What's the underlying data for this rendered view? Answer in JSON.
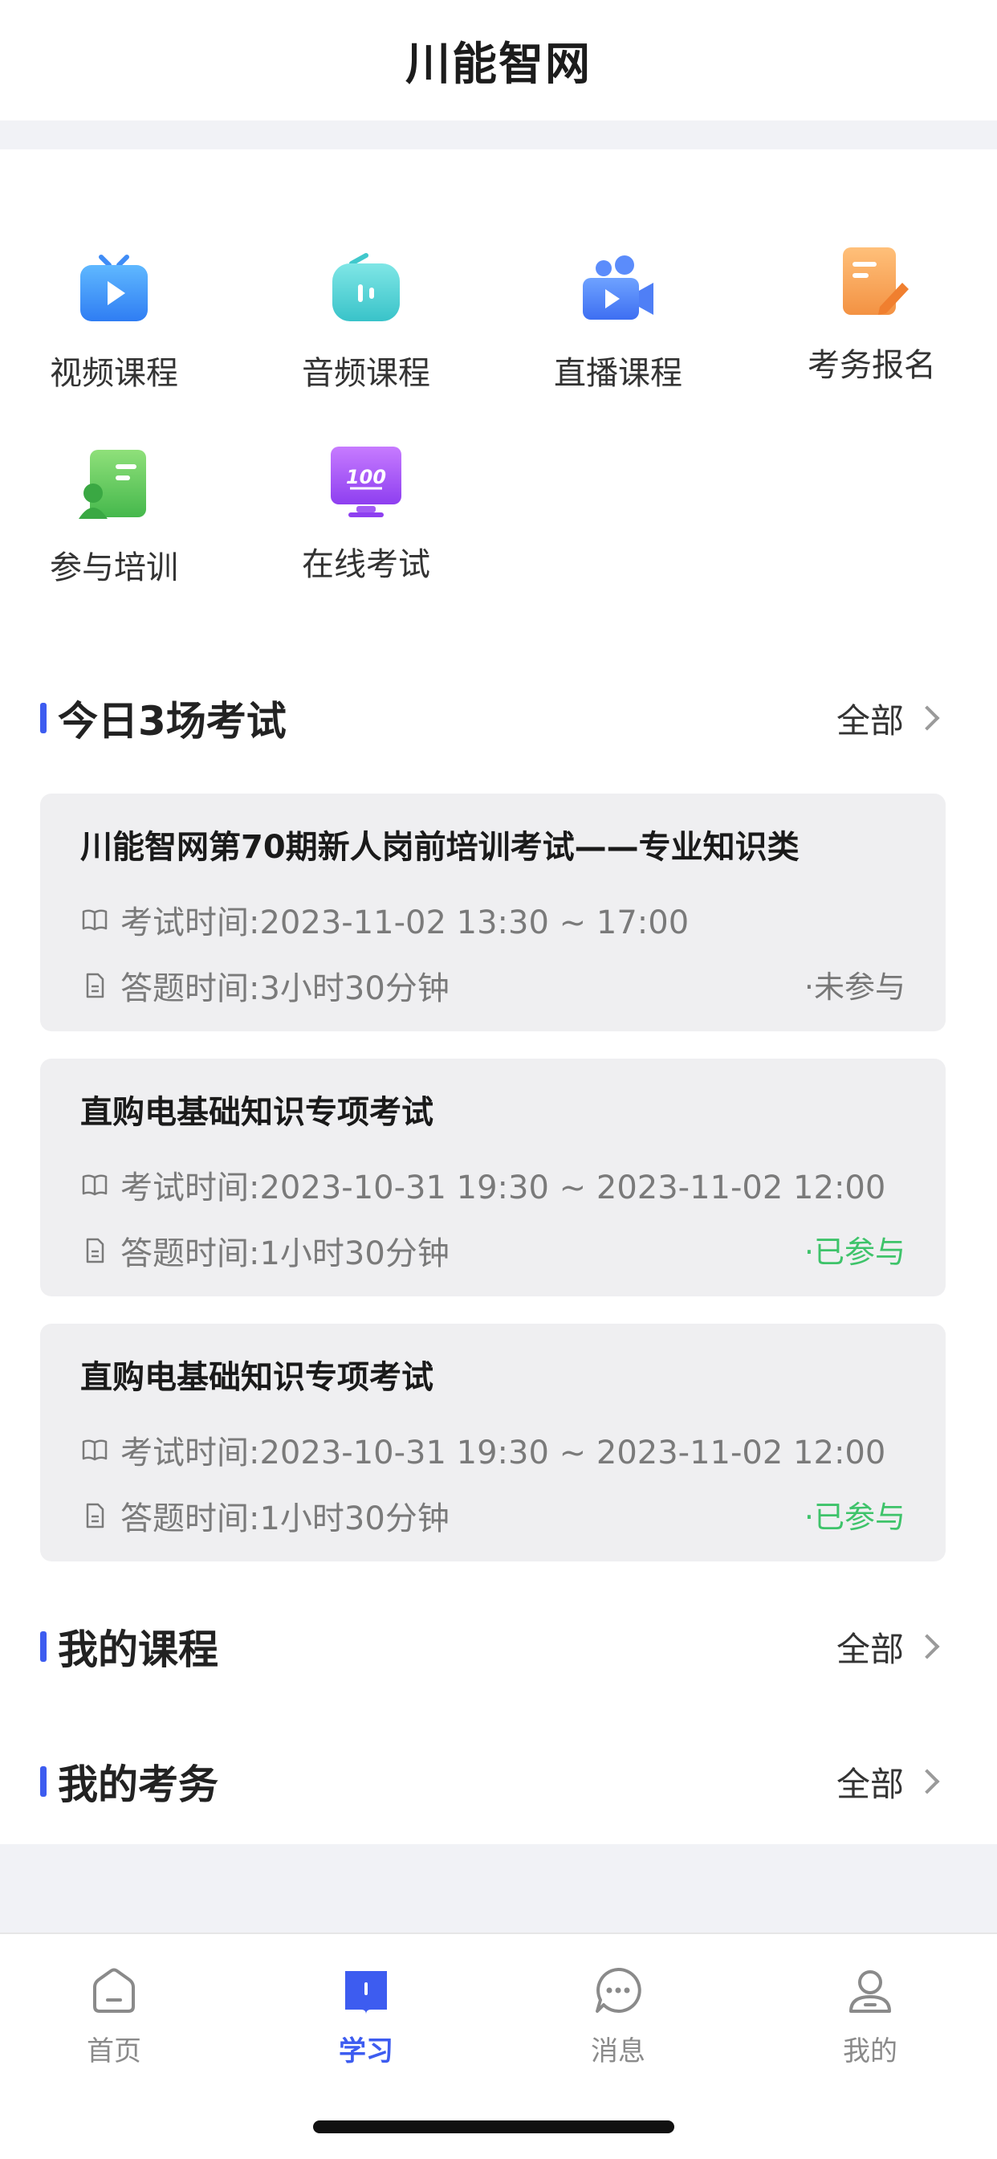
{
  "nav": {
    "title": "川能智网"
  },
  "quick_entries": [
    {
      "label": "视频课程",
      "icon": "video-tv-icon"
    },
    {
      "label": "音频课程",
      "icon": "audio-icon"
    },
    {
      "label": "直播课程",
      "icon": "live-camera-icon"
    },
    {
      "label": "考务报名",
      "icon": "signup-edit-icon"
    },
    {
      "label": "参与培训",
      "icon": "training-icon"
    },
    {
      "label": "在线考试",
      "icon": "online-exam-icon"
    }
  ],
  "today_exams": {
    "title": "今日3场考试",
    "more_label": "全部",
    "items": [
      {
        "title": "川能智网第70期新人岗前培训考试——专业知识类",
        "exam_time": "考试时间:2023-11-02 13:30 ~ 17:00",
        "answer_time": "答题时间:3小时30分钟",
        "status": "·未参与",
        "status_color": "#777777"
      },
      {
        "title": "直购电基础知识专项考试",
        "exam_time": "考试时间:2023-10-31 19:30 ~ 2023-11-02 12:00",
        "answer_time": "答题时间:1小时30分钟",
        "status": "·已参与",
        "status_color": "#3ec36a"
      },
      {
        "title": "直购电基础知识专项考试",
        "exam_time": "考试时间:2023-10-31 19:30 ~ 2023-11-02 12:00",
        "answer_time": "答题时间:1小时30分钟",
        "status": "·已参与",
        "status_color": "#3ec36a"
      }
    ]
  },
  "my_courses": {
    "title": "我的课程",
    "more_label": "全部"
  },
  "my_exams": {
    "title": "我的考务",
    "more_label": "全部"
  },
  "tabbar": {
    "active_color": "#3d5cf0",
    "items": [
      {
        "label": "首页",
        "icon": "home-icon",
        "active": false
      },
      {
        "label": "学习",
        "icon": "study-book-icon",
        "active": true
      },
      {
        "label": "消息",
        "icon": "message-icon",
        "active": false
      },
      {
        "label": "我的",
        "icon": "profile-icon",
        "active": false
      }
    ]
  },
  "colors": {
    "accent": "#3d5cf0",
    "background_gap": "#f1f2f6",
    "card_bg": "#efeff1"
  }
}
